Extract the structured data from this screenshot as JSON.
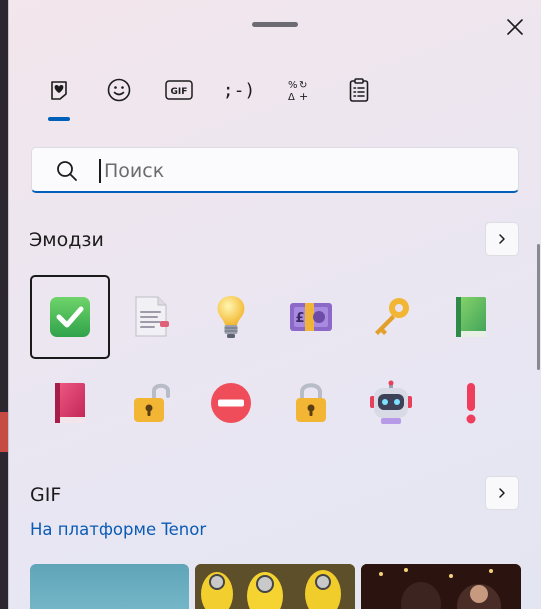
{
  "tabs": [
    {
      "name": "favorites",
      "icon": "heart-note-icon"
    },
    {
      "name": "emoji",
      "icon": "smiley-icon"
    },
    {
      "name": "gif",
      "icon": "gif-icon",
      "label": "GIF"
    },
    {
      "name": "kaomoji",
      "icon": "kaomoji-icon",
      "label": ";-)"
    },
    {
      "name": "symbols",
      "icon": "symbols-icon"
    },
    {
      "name": "clipboard",
      "icon": "clipboard-icon"
    }
  ],
  "search": {
    "placeholder": "Поиск",
    "value": ""
  },
  "emoji_section": {
    "title": "Эмодзи",
    "items": [
      {
        "name": "check-mark-button",
        "selected": true
      },
      {
        "name": "page-with-curl"
      },
      {
        "name": "light-bulb"
      },
      {
        "name": "pound-banknote"
      },
      {
        "name": "key"
      },
      {
        "name": "green-book"
      },
      {
        "name": "closed-book"
      },
      {
        "name": "unlocked"
      },
      {
        "name": "no-entry"
      },
      {
        "name": "locked"
      },
      {
        "name": "robot"
      },
      {
        "name": "exclamation-mark"
      }
    ]
  },
  "gif_section": {
    "title": "GIF",
    "subtitle": "На платформе Tenor"
  },
  "colors": {
    "accent": "#005fb8",
    "link": "#0a5bb4"
  }
}
